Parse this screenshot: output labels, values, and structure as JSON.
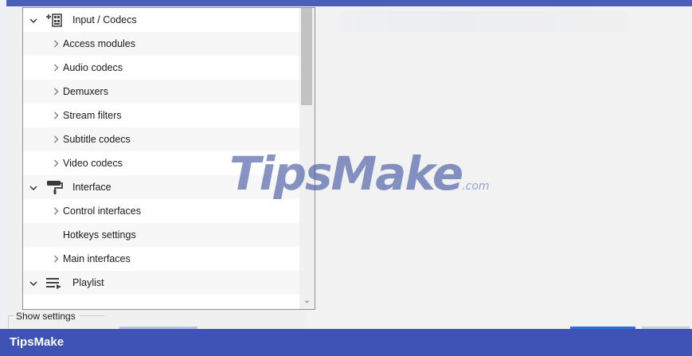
{
  "tree": {
    "rows": [
      {
        "type": "category",
        "label": "Input / Codecs",
        "expanded": true,
        "icon": "input-codecs-icon"
      },
      {
        "type": "subitem",
        "label": "Access modules",
        "has_children": true
      },
      {
        "type": "subitem",
        "label": "Audio codecs",
        "has_children": true
      },
      {
        "type": "subitem",
        "label": "Demuxers",
        "has_children": true
      },
      {
        "type": "subitem",
        "label": "Stream filters",
        "has_children": true
      },
      {
        "type": "subitem",
        "label": "Subtitle codecs",
        "has_children": true
      },
      {
        "type": "subitem",
        "label": "Video codecs",
        "has_children": true
      },
      {
        "type": "category",
        "label": "Interface",
        "expanded": true,
        "icon": "paint-roller-icon"
      },
      {
        "type": "subitem",
        "label": "Control interfaces",
        "has_children": true
      },
      {
        "type": "subitem",
        "label": "Hotkeys settings",
        "has_children": false
      },
      {
        "type": "subitem",
        "label": "Main interfaces",
        "has_children": true
      },
      {
        "type": "category",
        "label": "Playlist",
        "expanded": true,
        "icon": "playlist-icon"
      }
    ],
    "expanded_glyph": "⌄",
    "collapsed_glyph": "›"
  },
  "scrollbar": {
    "down_arrow": "⌄"
  },
  "show_settings": {
    "label": "Show settings"
  },
  "footer": {
    "title": "TipsMake"
  },
  "watermark": {
    "main": "TipsMake",
    "suffix": ".com"
  },
  "colors": {
    "accent": "#3f52b5",
    "watermark": "#3f54a0"
  }
}
